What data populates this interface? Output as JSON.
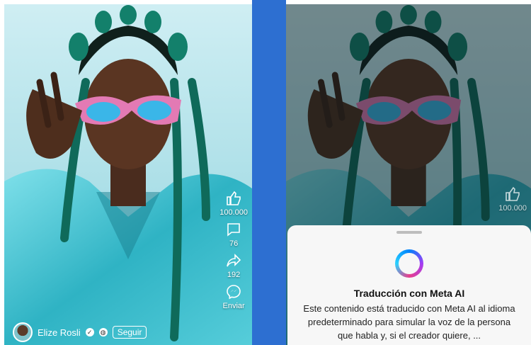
{
  "left_panel": {
    "actions": {
      "like_count": "100.000",
      "comment_count": "76",
      "share_count": "192",
      "send_label": "Enviar"
    },
    "creator": {
      "name": "Elize Rosli",
      "follow_label": "Seguir"
    }
  },
  "right_panel": {
    "actions": {
      "like_count": "100.000"
    },
    "sheet": {
      "title": "Traducción con Meta AI",
      "body": "Este contenido está traducido con Meta AI al idioma predeterminado para simular la voz de la persona que habla y, si el creador quiere, ..."
    }
  },
  "colors": {
    "divider": "#2d6fd1",
    "background_cyan": "#a9dde6",
    "shirt": "#3fc0cf",
    "braids": "#0f6a5a"
  }
}
